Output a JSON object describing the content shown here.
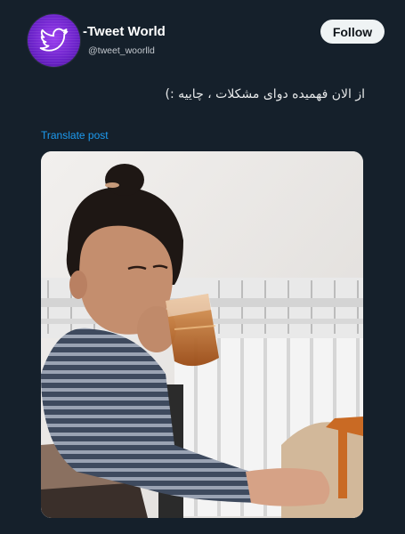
{
  "account": {
    "display_name": "-Tweet World",
    "handle": "@tweet_woorlld",
    "avatar_icon": "twitter-bird-icon",
    "avatar_color": "#7b2ee0"
  },
  "actions": {
    "follow_label": "Follow"
  },
  "post": {
    "text": "از الان فهمیده دوای مشکلات ، چاییه :)",
    "translate_label": "Translate post"
  },
  "theme": {
    "background": "#15202b",
    "link_color": "#1d9bf0",
    "button_bg": "#eff3f4"
  }
}
